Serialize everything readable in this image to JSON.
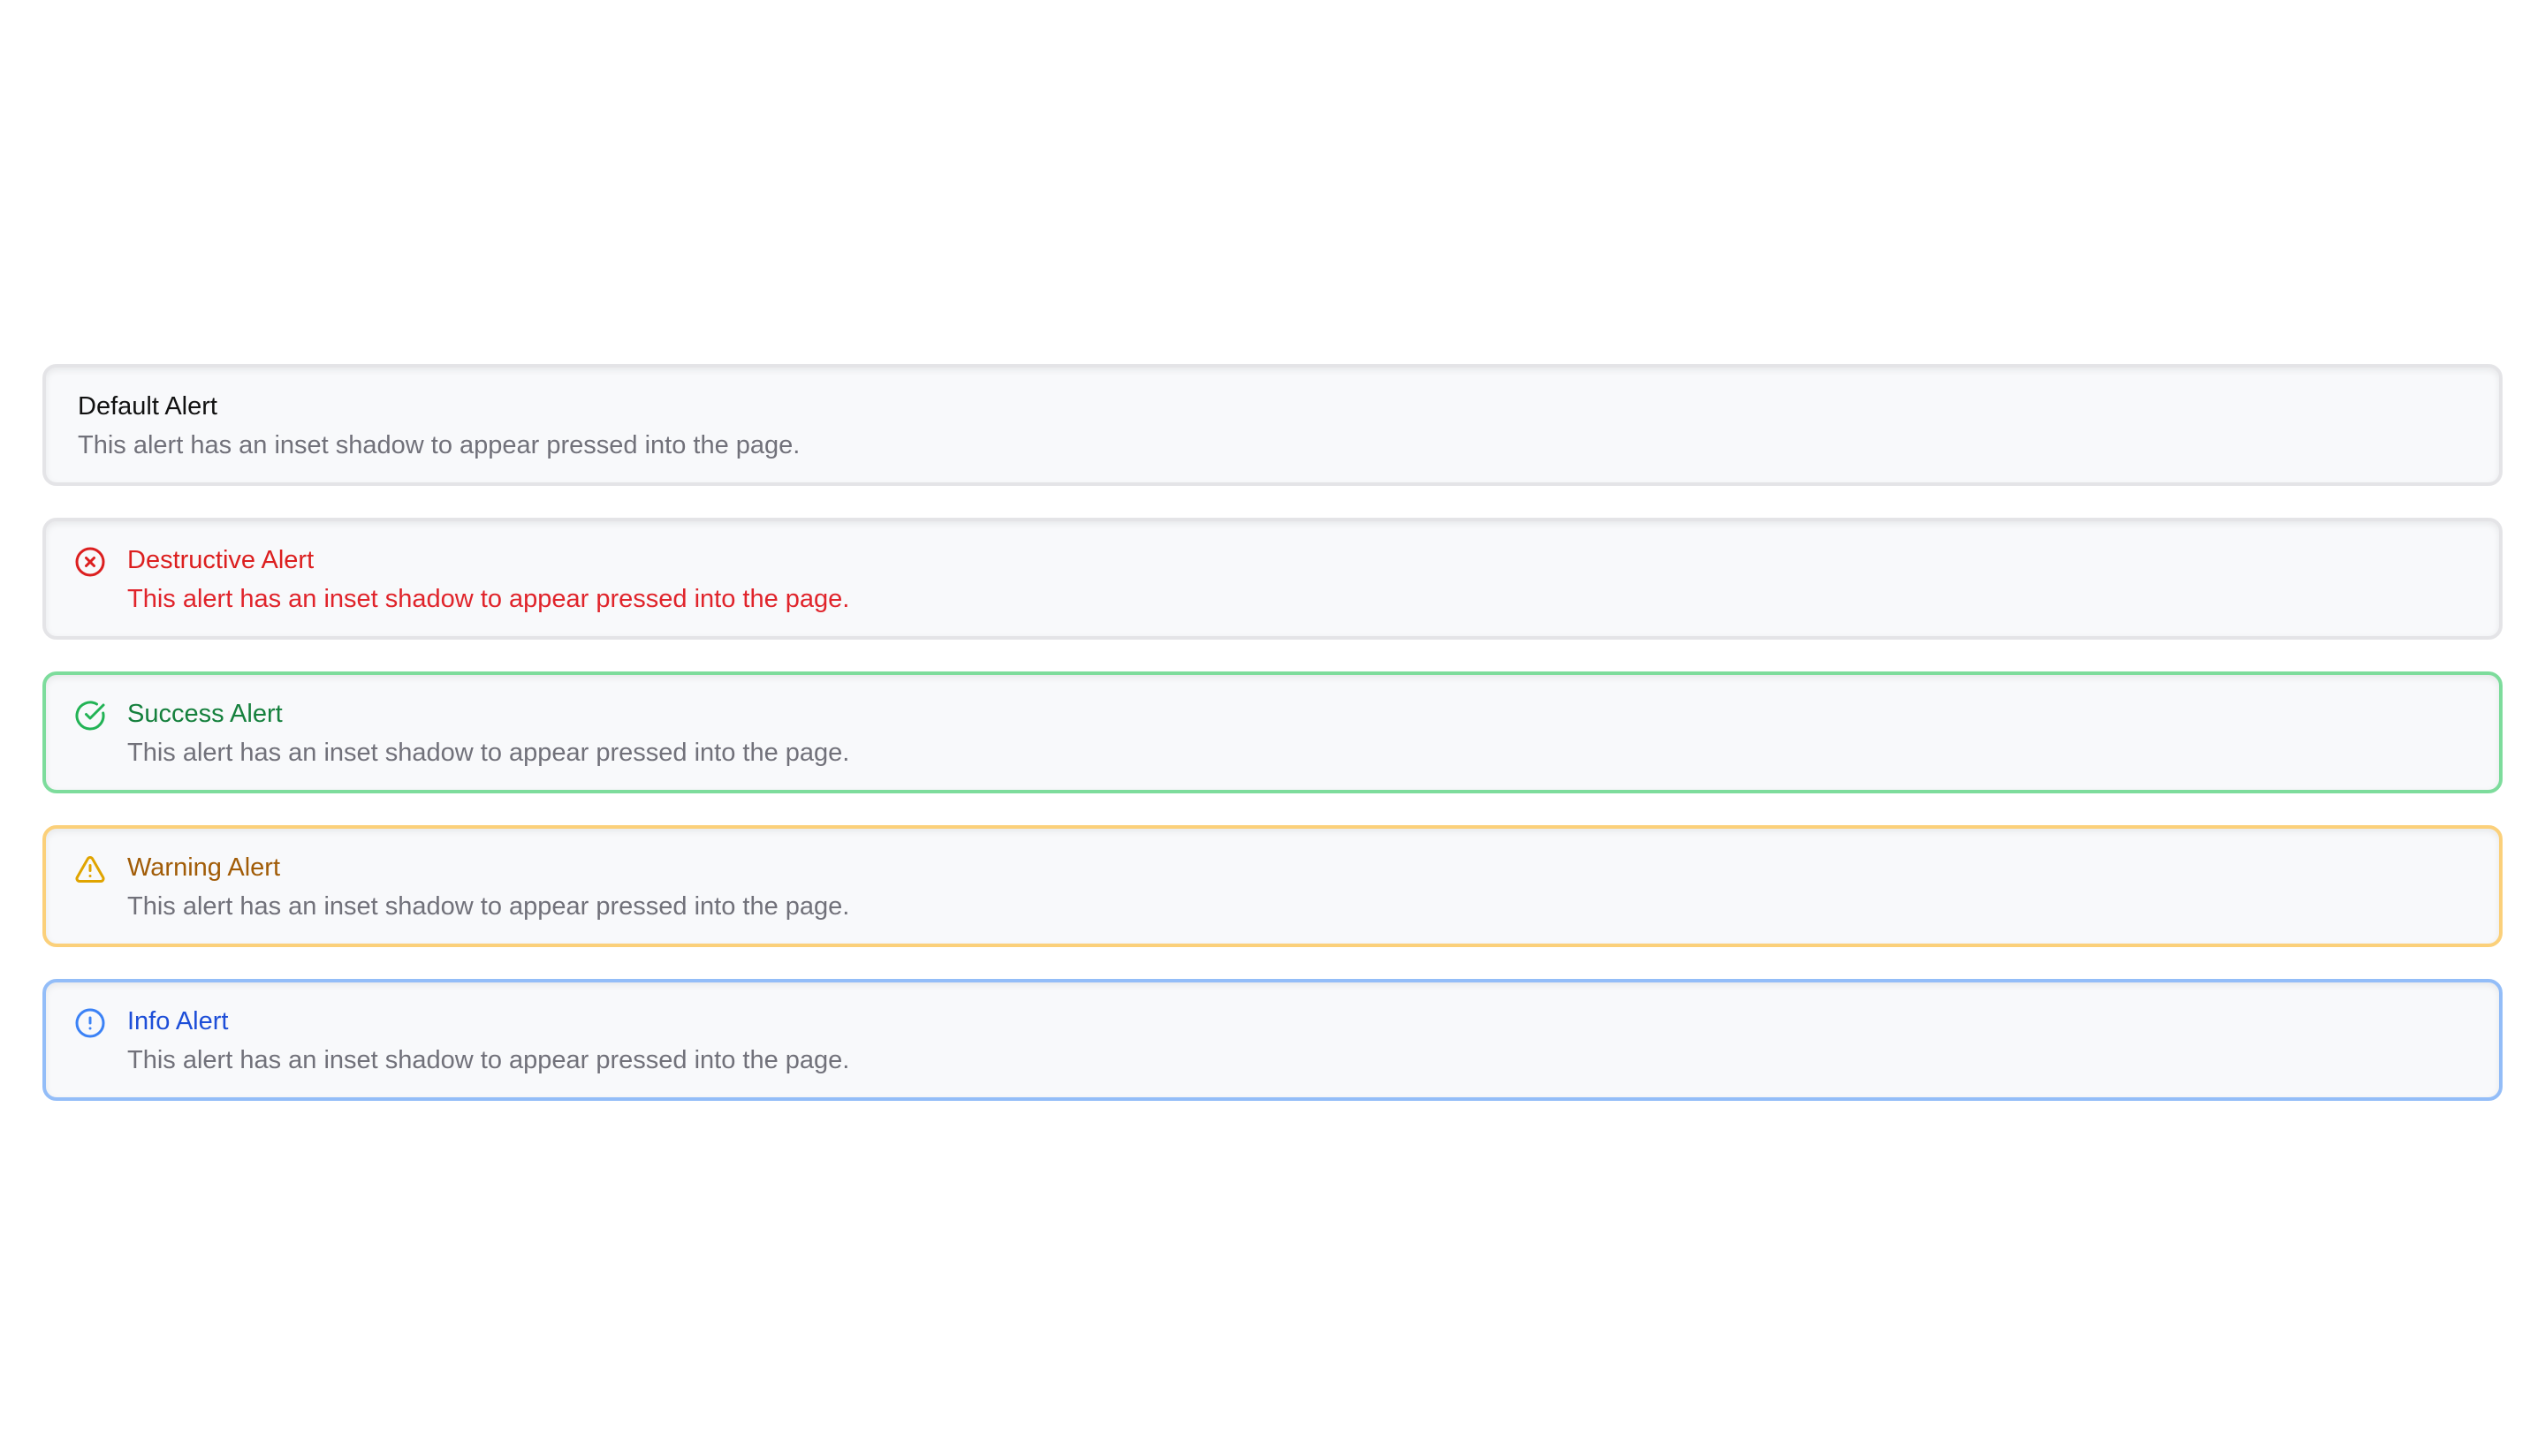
{
  "colors": {
    "default_title": "#111111",
    "description": "#71717a",
    "destructive": "#dc1f1f",
    "success": "#15803d",
    "success_border": "#7ddc9c",
    "warning": "#a15c07",
    "warning_border": "#fbd07a",
    "info": "#1d4ed8",
    "info_border": "#93bdf8",
    "alert_background": "#f8f9fb"
  },
  "alerts": [
    {
      "variant": "default",
      "icon": "",
      "title": "Default Alert",
      "description": "This alert has an inset shadow to appear pressed into the page."
    },
    {
      "variant": "destructive",
      "icon": "x-circle-icon",
      "title": "Destructive Alert",
      "description": "This alert has an inset shadow to appear pressed into the page."
    },
    {
      "variant": "success",
      "icon": "check-circle-icon",
      "title": "Success Alert",
      "description": "This alert has an inset shadow to appear pressed into the page."
    },
    {
      "variant": "warning",
      "icon": "warning-triangle-icon",
      "title": "Warning Alert",
      "description": "This alert has an inset shadow to appear pressed into the page."
    },
    {
      "variant": "info",
      "icon": "info-circle-icon",
      "title": "Info Alert",
      "description": "This alert has an inset shadow to appear pressed into the page."
    }
  ]
}
